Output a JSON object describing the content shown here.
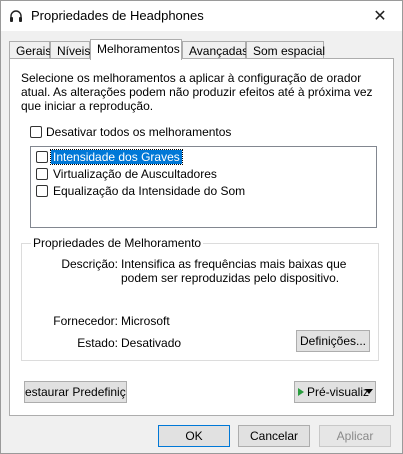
{
  "window": {
    "title": "Propriedades de Headphones",
    "close_label": "✕"
  },
  "tabs": [
    {
      "label": "Gerais"
    },
    {
      "label": "Níveis"
    },
    {
      "label": "Melhoramentos"
    },
    {
      "label": "Avançadas"
    },
    {
      "label": "Som espacial"
    }
  ],
  "active_tab": "Melhoramentos",
  "enhancements": {
    "description": "Selecione os melhoramentos a aplicar à configuração de orador atual. As alterações podem não produzir efeitos até à próxima vez que iniciar a reprodução.",
    "disable_all_label": "Desativar todos os melhoramentos",
    "items": [
      {
        "label": "Intensidade dos Graves",
        "checked": false,
        "selected": true
      },
      {
        "label": "Virtualização de Auscultadores",
        "checked": false,
        "selected": false
      },
      {
        "label": "Equalização da Intensidade do Som",
        "checked": false,
        "selected": false
      }
    ]
  },
  "properties": {
    "group_title": "Propriedades de Melhoramento",
    "description_label": "Descrição:",
    "description_value": "Intensifica as frequências mais baixas que podem ser reproduzidas pelo dispositivo.",
    "provider_label": "Fornecedor:",
    "provider_value": "Microsoft",
    "status_label": "Estado:",
    "status_value": "Desativado",
    "settings_button": "Definições..."
  },
  "buttons": {
    "restore_defaults": "estaurar Predefiniçõe",
    "preview": "Pré-visualiz",
    "ok": "OK",
    "cancel": "Cancelar",
    "apply": "Aplicar"
  },
  "colors": {
    "selection": "#0078d7",
    "play_icon": "#2a9d3f"
  }
}
